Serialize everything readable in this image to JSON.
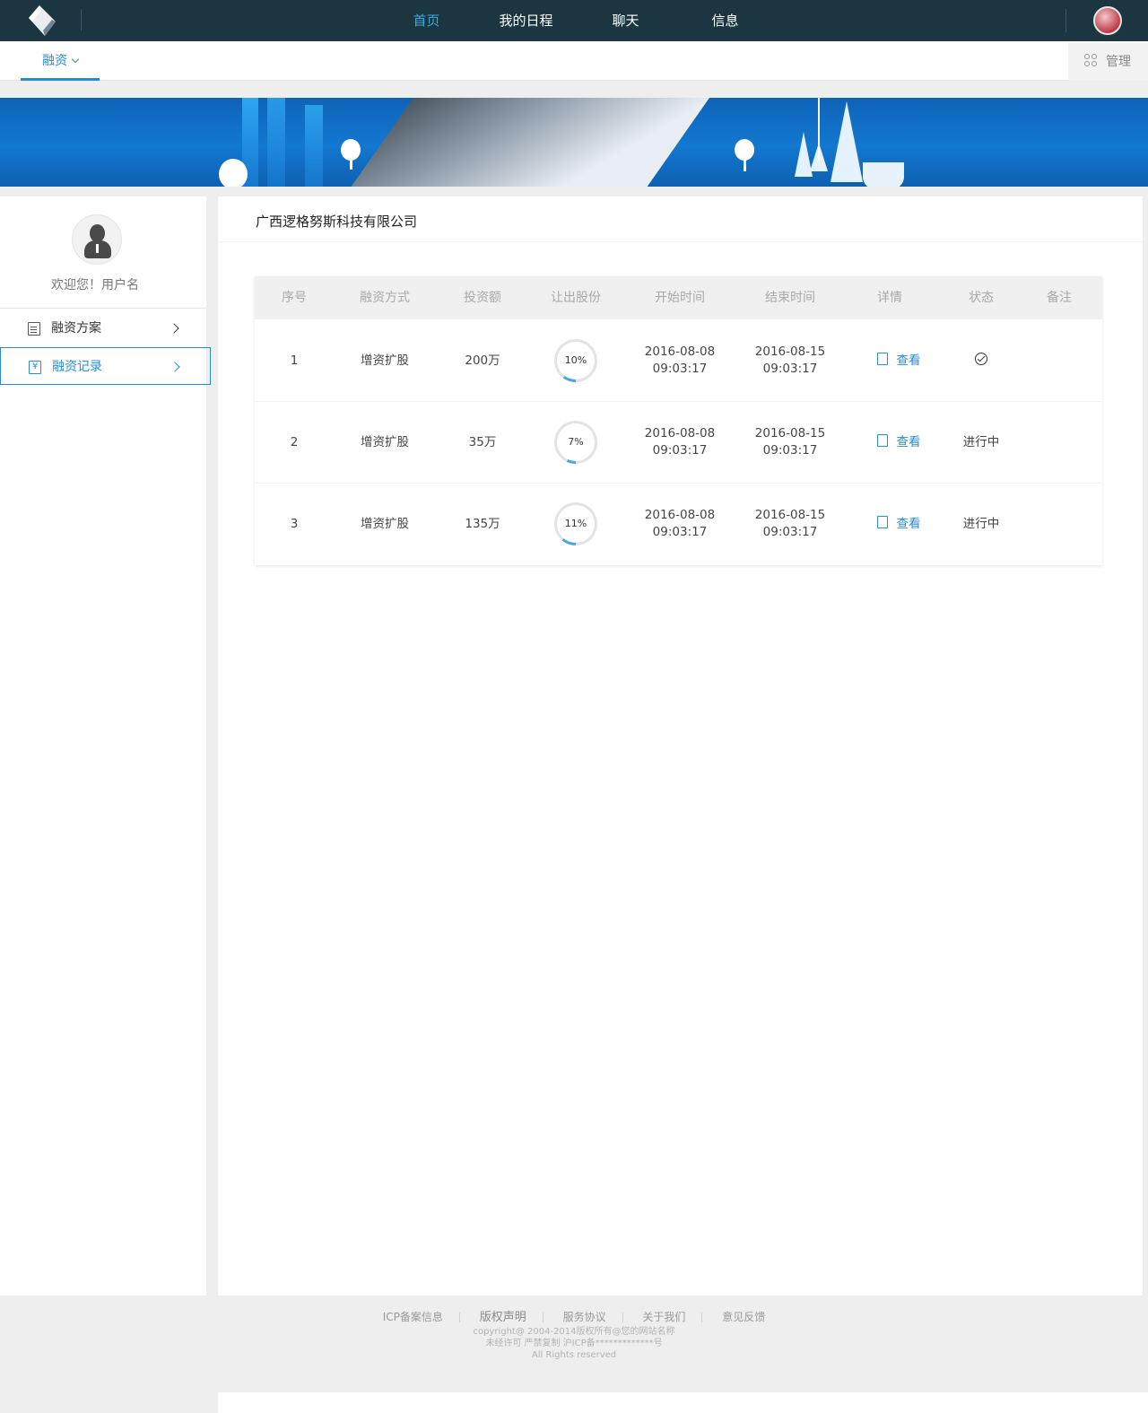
{
  "nav": {
    "items": [
      {
        "label": "首页",
        "active": true
      },
      {
        "label": "我的日程",
        "active": false
      },
      {
        "label": "聊天",
        "active": false
      },
      {
        "label": "信息",
        "active": false
      }
    ]
  },
  "subbar": {
    "tab_label": "融资",
    "manage_label": "管理"
  },
  "sidebar": {
    "welcome": "欢迎您！用户名",
    "items": [
      {
        "label": "融资方案",
        "icon": "clipboard-icon"
      },
      {
        "label": "融资记录",
        "icon": "yen-calendar-icon"
      }
    ]
  },
  "main": {
    "company": "广西逻格努斯科技有限公司",
    "table": {
      "headers": [
        "序号",
        "融资方式",
        "投资额",
        "让出股份",
        "开始时间",
        "结束时间",
        "详情",
        "状态",
        "备注"
      ],
      "rows": [
        {
          "index": "1",
          "method": "增资扩股",
          "amount": "200万",
          "share_label": "10%",
          "share": 10,
          "start_date": "2016-08-08",
          "start_time": "09:03:17",
          "end_date": "2016-08-15",
          "end_time": "09:03:17",
          "detail": "查看",
          "status": "",
          "status_icon": "check-circle-icon",
          "note": ""
        },
        {
          "index": "2",
          "method": "增资扩股",
          "amount": "35万",
          "share_label": "7%",
          "share": 7,
          "start_date": "2016-08-08",
          "start_time": "09:03:17",
          "end_date": "2016-08-15",
          "end_time": "09:03:17",
          "detail": "查看",
          "status": "进行中",
          "note": ""
        },
        {
          "index": "3",
          "method": "增资扩股",
          "amount": "135万",
          "share_label": "11%",
          "share": 11,
          "start_date": "2016-08-08",
          "start_time": "09:03:17",
          "end_date": "2016-08-15",
          "end_time": "09:03:17",
          "detail": "查看",
          "status": "进行中",
          "note": ""
        }
      ]
    }
  },
  "footer": {
    "links": [
      "ICP备案信息",
      "版权声明",
      "服务协议",
      "关于我们",
      "意见反馈"
    ],
    "copyright": "copyright@ 2004-2014版权所有@您的网站名称",
    "license": "未经许可 严禁复制 沪ICP备*************号",
    "rights": "All Rights reserved"
  },
  "colors": {
    "topbar": "#1b3640",
    "accent": "#2a8ccb",
    "nav_active": "#3fa9e0",
    "ring_progress": "#4aa6de",
    "ring_track": "#e3e3e3"
  }
}
